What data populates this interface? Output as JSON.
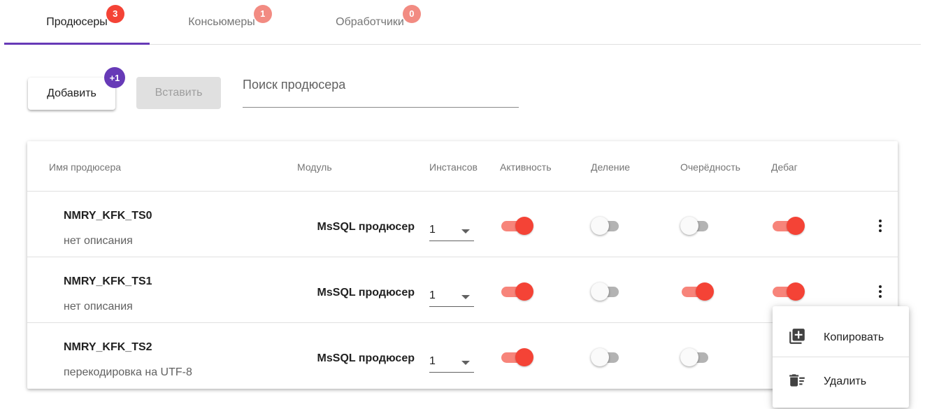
{
  "tabs": [
    {
      "label": "Продюсеры",
      "badge": "3",
      "badge_color": "#f44336",
      "active": true
    },
    {
      "label": "Консьюмеры",
      "badge": "1",
      "badge_color": "#f28b82",
      "active": false
    },
    {
      "label": "Обработчики",
      "badge": "0",
      "badge_color": "#f28b82",
      "active": false
    }
  ],
  "accent_color": "#673ab7",
  "toolbar": {
    "add_label": "Добавить",
    "add_badge": "+1",
    "paste_label": "Вставить",
    "search_placeholder": "Поиск продюсера"
  },
  "table": {
    "headers": {
      "name": "Имя продюсера",
      "module": "Модуль",
      "instances": "Инстансов",
      "active": "Активность",
      "split": "Деление",
      "order": "Очерёдность",
      "debug": "Дебаг"
    },
    "rows": [
      {
        "name": "NMRY_KFK_TS0",
        "description": "нет описания",
        "module": "MsSQL продюсер",
        "instances": "1",
        "active": true,
        "split": false,
        "order": false,
        "debug": true
      },
      {
        "name": "NMRY_KFK_TS1",
        "description": "нет описания",
        "module": "MsSQL продюсер",
        "instances": "1",
        "active": true,
        "split": false,
        "order": true,
        "debug": true
      },
      {
        "name": "NMRY_KFK_TS2",
        "description": "перекодировка на UTF-8",
        "module": "MsSQL продюсер",
        "instances": "1",
        "active": true,
        "split": false,
        "order": false,
        "debug": true
      }
    ]
  },
  "context_menu": {
    "items": [
      {
        "label": "Копировать",
        "icon": "library-add-icon"
      },
      {
        "label": "Удалить",
        "icon": "delete-sweep-icon"
      }
    ]
  },
  "colors": {
    "toggle_on_thumb": "#f44336",
    "toggle_on_track": "#f7847a",
    "toggle_off_track": "#b3b3b3"
  }
}
